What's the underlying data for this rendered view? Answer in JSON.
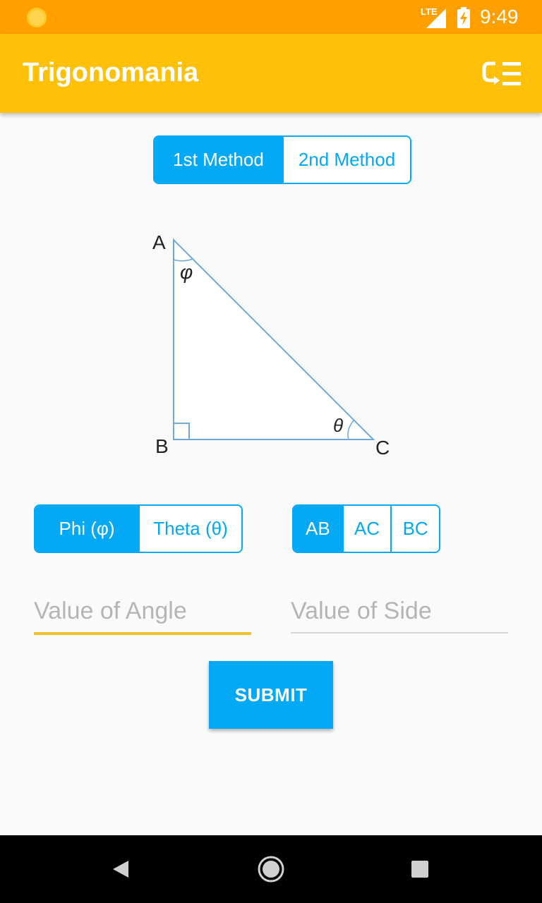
{
  "status_bar": {
    "network": "LTE",
    "time": "9:49",
    "icons": [
      "weather-sun-icon",
      "signal-icon",
      "battery-charging-icon"
    ]
  },
  "app_bar": {
    "title": "Trigonomania",
    "menu_icon": "menu-icon"
  },
  "method_toggle": {
    "options": [
      "1st Method",
      "2nd Method"
    ],
    "selected": "1st Method"
  },
  "diagram": {
    "vertex_a": "A",
    "vertex_b": "B",
    "vertex_c": "C",
    "angle_phi": "φ",
    "angle_theta": "θ"
  },
  "angle_toggle": {
    "options": [
      "Phi (φ)",
      "Theta (θ)"
    ],
    "selected": "Phi (φ)"
  },
  "side_toggle": {
    "options": [
      "AB",
      "AC",
      "BC"
    ],
    "selected": "AB"
  },
  "inputs": {
    "angle": {
      "placeholder": "Value of Angle",
      "value": ""
    },
    "side": {
      "placeholder": "Value of Side",
      "value": ""
    }
  },
  "submit": {
    "label": "SUBMIT"
  },
  "colors": {
    "status_bar": "#ffa000",
    "app_bar": "#ffc107",
    "accent": "#03a9f4",
    "focus_underline": "#f2c12e"
  },
  "nav_bar": {
    "icons": [
      "back-icon",
      "home-icon",
      "recents-icon"
    ]
  }
}
